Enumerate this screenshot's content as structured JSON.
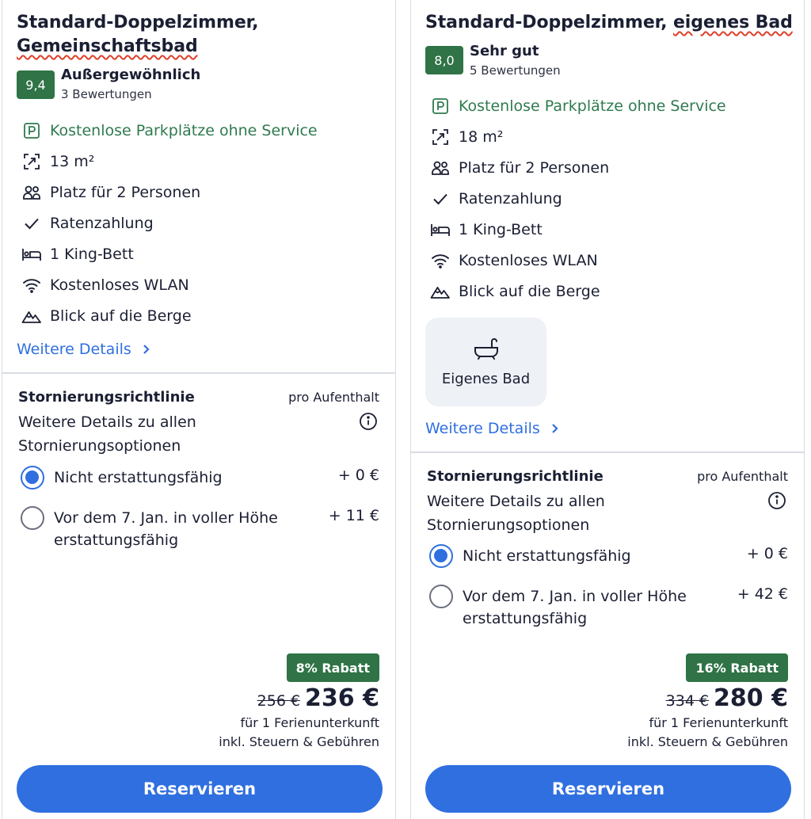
{
  "rooms": [
    {
      "title_part1": "Standard-Doppelzimmer,",
      "title_part2": "Gemeinschaftsbad",
      "rating": {
        "score": "9,4",
        "label": "Außergewöhnlich",
        "count": "3 Bewertungen"
      },
      "features": {
        "parking": "Kostenlose Parkplätze ohne Service",
        "size": "13 m²",
        "capacity": "Platz für 2 Personen",
        "payment": "Ratenzahlung",
        "bed": "1 King-Bett",
        "wifi": "Kostenloses WLAN",
        "view": "Blick auf die Berge"
      },
      "more_details": "Weitere Details",
      "policy": {
        "title": "Stornierungsrichtlinie",
        "per": "pro Aufenthalt",
        "description": "Weitere Details zu allen Stornierungsoptionen",
        "options": [
          {
            "label": "Nicht erstattungsfähig",
            "price": "+ 0 €",
            "selected": true
          },
          {
            "label": "Vor dem 7. Jan. in voller Höhe erstattungsfähig",
            "price": "+ 11 €",
            "selected": false
          }
        ]
      },
      "discount": "8% Rabatt",
      "price_old": "256 €",
      "price_new": "236 €",
      "price_note_1": "für 1 Ferienunterkunft",
      "price_note_2": "inkl. Steuern & Gebühren",
      "reserve_label": "Reservieren"
    },
    {
      "title_part1": "Standard-Doppelzimmer, ",
      "title_part2": "eigenes Bad",
      "rating": {
        "score": "8,0",
        "label": "Sehr gut",
        "count": "5 Bewertungen"
      },
      "features": {
        "parking": "Kostenlose Parkplätze ohne Service",
        "size": "18 m²",
        "capacity": "Platz für 2 Personen",
        "payment": "Ratenzahlung",
        "bed": "1 King-Bett",
        "wifi": "Kostenloses WLAN",
        "view": "Blick auf die Berge"
      },
      "highlight": "Eigenes Bad",
      "more_details": "Weitere Details",
      "policy": {
        "title": "Stornierungsrichtlinie",
        "per": "pro Aufenthalt",
        "description": "Weitere Details zu allen Stornierungsoptionen",
        "options": [
          {
            "label": "Nicht erstattungsfähig",
            "price": "+ 0 €",
            "selected": true
          },
          {
            "label": "Vor dem 7. Jan. in voller Höhe erstattungsfähig",
            "price": "+ 42 €",
            "selected": false
          }
        ]
      },
      "discount": "16% Rabatt",
      "price_old": "334 €",
      "price_new": "280 €",
      "price_note_1": "für 1 Ferienunterkunft",
      "price_note_2": "inkl. Steuern & Gebühren",
      "reserve_label": "Reservieren"
    }
  ],
  "colors": {
    "accent": "#2f6fe0",
    "rating_green": "#2f7346",
    "feature_green": "#2f7a4e",
    "squiggle": "#e0402a"
  }
}
